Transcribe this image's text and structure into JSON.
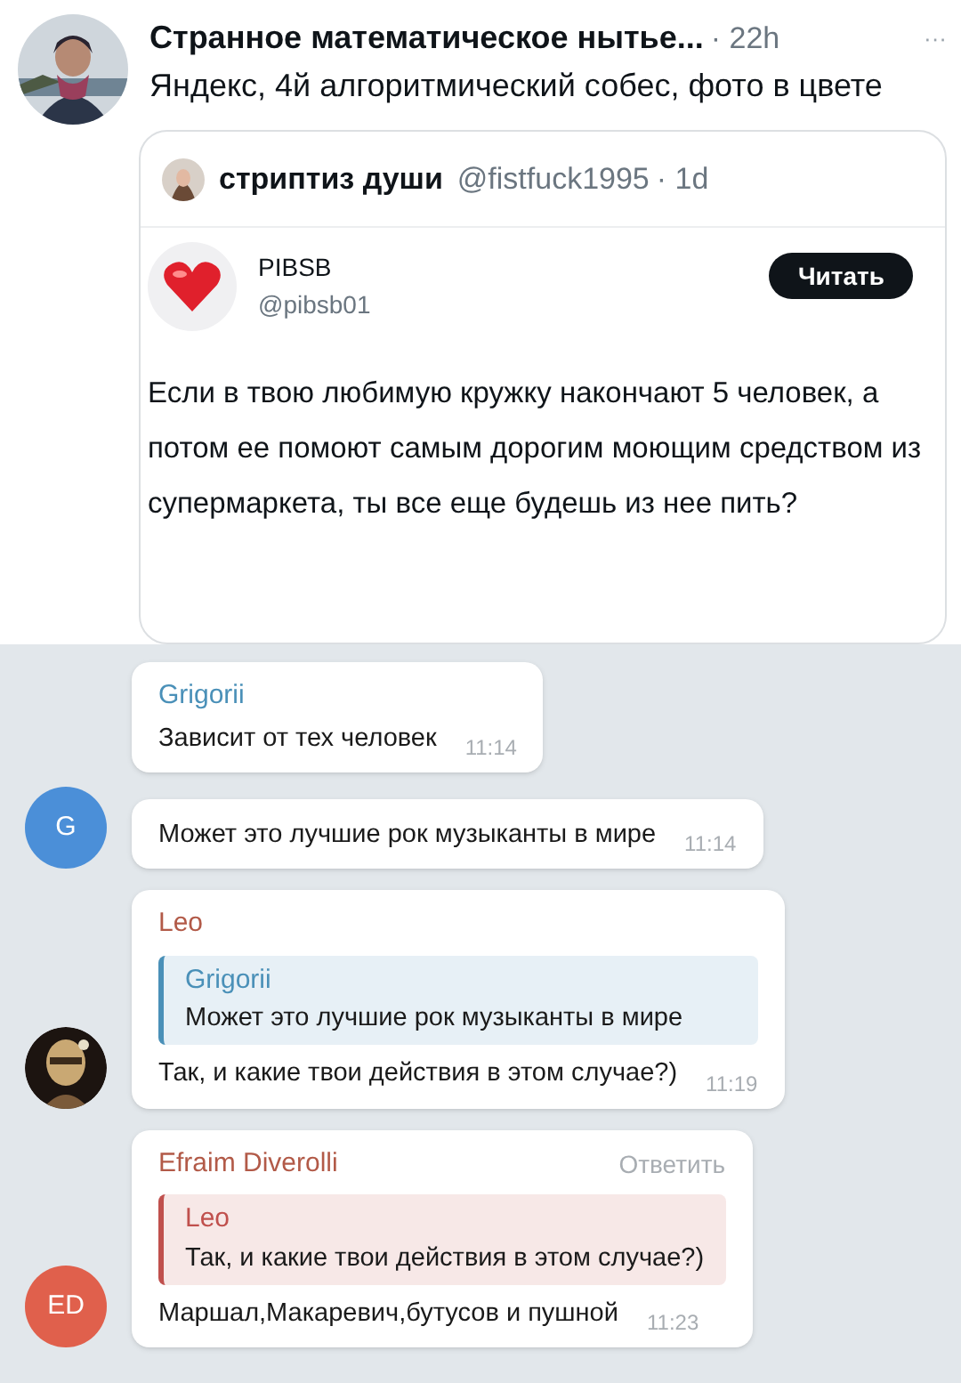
{
  "tweet": {
    "author": "Странное математическое нытье...",
    "time": "· 22h",
    "more": "···",
    "text": "Яндекс, 4й алгоритмический собес, фото в цвете",
    "quote": {
      "author": "стриптиз души",
      "handle": "@fistfuck1995",
      "time": "· 1d",
      "card": {
        "name": "PIBSB",
        "handle": "@pibsb01",
        "button": "Читать",
        "text": "Если в твою любимую кружку накончают 5 человек, а потом ее помоют самым дорогим моющим средством из супермаркета, ты все еще будешь из нее пить?"
      }
    }
  },
  "chat": {
    "messages": [
      {
        "sender": {
          "name": "Grigorii",
          "color": "#4a90b8"
        },
        "text": "Зависит от тех человек",
        "time": "11:14"
      },
      {
        "avatar": {
          "kind": "letter",
          "label": "G",
          "color": "#4b8fd8"
        },
        "text": "Может это лучшие рок музыканты в мире",
        "time": "11:14"
      },
      {
        "sender": {
          "name": "Leo",
          "color": "#b25a48"
        },
        "reply": {
          "name": "Grigorii",
          "text": "Может это лучшие рок музыканты в мире",
          "color": "#4a90b8"
        },
        "text": "Так, и какие твои действия в этом случае?)",
        "time": "11:19"
      },
      {
        "avatar": {
          "kind": "letter",
          "label": "ED",
          "color": "#e0604c"
        },
        "sender": {
          "name": "Efraim Diverolli",
          "color": "#b25a48"
        },
        "action": "Ответить",
        "reply": {
          "name": "Leo",
          "text": "Так, и какие твои действия в этом случае?)",
          "color": "#c0504d"
        },
        "text": "Маршал,Макаревич,бутусов и пушной",
        "time": "11:23"
      }
    ]
  }
}
